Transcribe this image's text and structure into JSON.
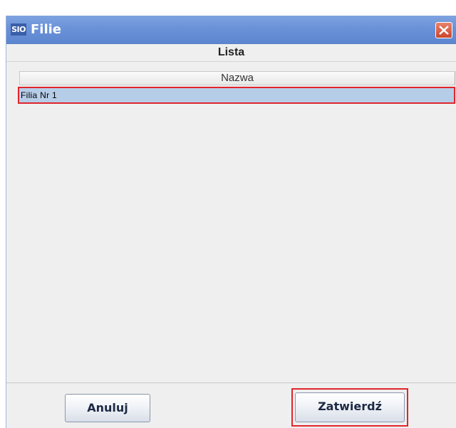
{
  "window": {
    "title": "Filie",
    "app_badge": "SIO"
  },
  "panel": {
    "header": "Lista"
  },
  "table": {
    "columns": [
      "Nazwa"
    ],
    "rows": [
      {
        "name": "Filia Nr 1",
        "selected": true
      }
    ]
  },
  "buttons": {
    "cancel": "Anuluj",
    "confirm": "Zatwierdź"
  },
  "colors": {
    "title_bar": "#6a92d8",
    "selection": "#b6cde8",
    "highlight_outline": "#e0252b"
  }
}
